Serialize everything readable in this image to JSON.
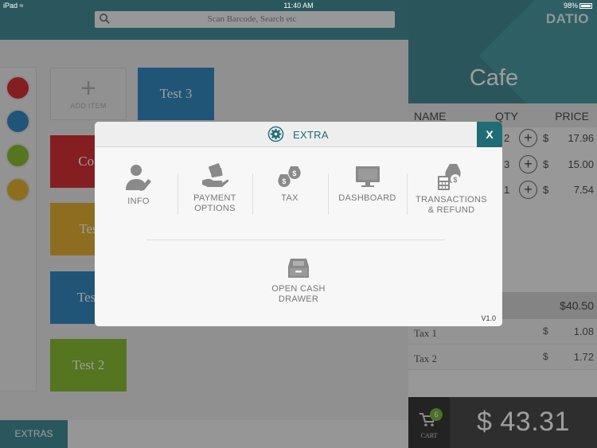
{
  "status_bar": {
    "device": "iPad",
    "time": "11:40 AM",
    "battery": "98%"
  },
  "search": {
    "placeholder": "Scan Barcode, Search etc"
  },
  "colors": {
    "accent": "#2a7f89",
    "red": "#d0171d",
    "blue": "#1a7ab8",
    "green": "#7ab51d",
    "gold": "#e0a81c"
  },
  "color_filters": [
    "#d0171d",
    "#1a7ab8",
    "#7ab51d",
    "#e0a81c"
  ],
  "tiles": {
    "add_label": "ADD ITEM",
    "items": [
      {
        "label": "Test 3",
        "color": "#1a7ab8"
      },
      {
        "label": "Cof",
        "color": "#d0171d"
      },
      {
        "label": "Tes",
        "color": "#e0a81c"
      },
      {
        "label": "Test",
        "color": "#1a7ab8"
      },
      {
        "label": "Test 2",
        "color": "#7ab51d"
      }
    ]
  },
  "extras_button": "EXTRAS",
  "order": {
    "brand": "DATIO",
    "store_name": "Cafe",
    "columns": {
      "name": "NAME",
      "qty": "QTY",
      "price": "PRICE"
    },
    "rows": [
      {
        "qty": "2",
        "currency": "$",
        "price": "17.96"
      },
      {
        "qty": "3",
        "currency": "$",
        "price": "15.00"
      },
      {
        "qty": "1",
        "currency": "$",
        "price": "7.54"
      }
    ],
    "subtotal": "$40.50",
    "taxes": [
      {
        "label": "Tax 1",
        "currency": "$",
        "value": "1.08"
      },
      {
        "label": "Tax 2",
        "currency": "$",
        "value": "1.72"
      }
    ],
    "cart": {
      "label": "CART",
      "count": "6"
    },
    "total": "$ 43.31"
  },
  "modal": {
    "title": "EXTRA",
    "close_label": "X",
    "options": [
      {
        "label": "INFO",
        "icon": "user-edit-icon"
      },
      {
        "label": "PAYMENT OPTIONS",
        "icon": "hand-money-icon"
      },
      {
        "label": "TAX",
        "icon": "money-bags-icon"
      },
      {
        "label": "DASHBOARD",
        "icon": "monitor-icon"
      },
      {
        "label": "TRANSACTIONS & REFUND",
        "icon": "calculator-bag-icon"
      },
      {
        "label": "OPEN CASH DRAWER",
        "icon": "cash-drawer-icon"
      }
    ],
    "version": "V1.0"
  }
}
